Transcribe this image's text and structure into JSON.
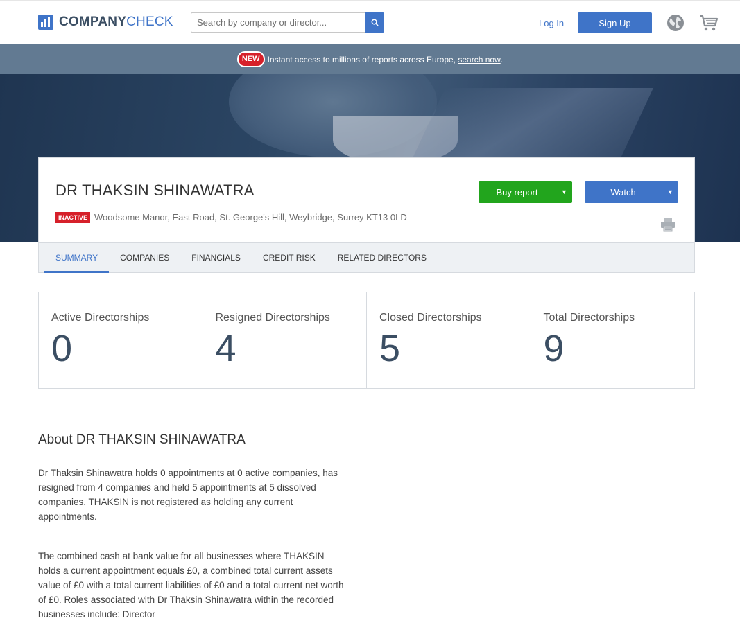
{
  "header": {
    "logo_part1": "COMPANY",
    "logo_part2": "CHECK",
    "search_placeholder": "Search by company or director...",
    "login": "Log In",
    "signup": "Sign Up"
  },
  "announcement": {
    "badge": "NEW",
    "text": "Instant access to millions of reports across Europe,",
    "link": "search now",
    "suffix": "."
  },
  "profile": {
    "name": "DR THAKSIN SHINAWATRA",
    "status": "INACTIVE",
    "address": "Woodsome Manor, East Road, St. George's Hill, Weybridge, Surrey KT13 0LD",
    "buy_label": "Buy report",
    "watch_label": "Watch"
  },
  "tabs": [
    {
      "label": "SUMMARY"
    },
    {
      "label": "COMPANIES"
    },
    {
      "label": "FINANCIALS"
    },
    {
      "label": "CREDIT RISK"
    },
    {
      "label": "RELATED DIRECTORS"
    }
  ],
  "stats": [
    {
      "label": "Active Directorships",
      "value": "0"
    },
    {
      "label": "Resigned Directorships",
      "value": "4"
    },
    {
      "label": "Closed Directorships",
      "value": "5"
    },
    {
      "label": "Total Directorships",
      "value": "9"
    }
  ],
  "about": {
    "title": "About DR THAKSIN SHINAWATRA",
    "paragraph1": "Dr Thaksin Shinawatra holds 0 appointments at 0 active companies, has resigned from 4 companies and held 5 appointments at 5 dissolved companies. THAKSIN is not registered as holding any current appointments.",
    "paragraph2": "The combined cash at bank value for all businesses where THAKSIN holds a current appointment equals £0, a combined total current assets value of £0 with a total current liabilities of £0 and a total current net worth of £0. Roles associated with Dr Thaksin Shinawatra within the recorded businesses include: Director"
  },
  "colors": {
    "brand_blue": "#3f74c8",
    "buy_green": "#22a51d",
    "inactive_red": "#d6202a",
    "banner_bg": "#627a92"
  },
  "icons": [
    "logo-mark-icon",
    "search-icon",
    "globe-icon",
    "cart-icon",
    "print-icon",
    "caret-down-icon"
  ]
}
